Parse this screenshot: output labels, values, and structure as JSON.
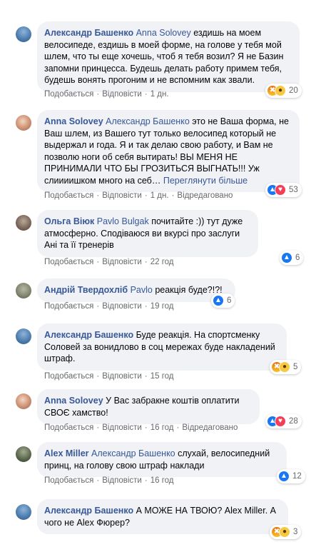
{
  "actions": {
    "like": "Подобається",
    "reply": "Відповісти",
    "edited": "Відредаговано"
  },
  "comments": [
    {
      "author": "Александр Башенко",
      "mention": "Anna Solovey",
      "text": "ездишь на моем велосипеде, ездишь в моей форме, на голове у тебя мой шлем, что ты еще хочешь, чтоб я тебя возил? Я не Базин запомни принцесса. Будешь делать работу примем тебя, будешь вонять прогоним и не вспомним как звали.",
      "time": "1 дн.",
      "reactions": [
        "angry-icon",
        "wow-icon"
      ],
      "count": "20"
    },
    {
      "author": "Anna Solovey",
      "mention": "Александр Башенко",
      "text": "это не Ваша форма, не Ваш шлем, из Вашего тут только велосипед который не выдержал и года. Я и так делаю свою работу, и Вам не позволю ноги об себя вытирать! ВЫ МЕНЯ НЕ ПРИНИМАЛИ ЧТО БЫ ГРОЗИТЬСЯ ВЫГНАТЬ!!! Уж слиииишком много на себ…",
      "more": "Переглянути більше",
      "time": "1 дн.",
      "edited": true,
      "reactions": [
        "like-icon",
        "love-icon"
      ],
      "count": "53"
    },
    {
      "author": "Ольга Віюк",
      "mention": "Pavlo Bulgak",
      "text": "почитайте :)) тут дуже атмосферно. Сподіваюся ви вкурсі про заслуги Ані та її тренерів",
      "time": "22 год",
      "reactions": [
        "like-icon"
      ],
      "count": "6"
    },
    {
      "author": "Андрій Твердохліб",
      "mention": "Pavlo",
      "text": "реакція буде?!?!",
      "time": "19 год",
      "reactions": [
        "like-icon"
      ],
      "count": "6"
    },
    {
      "author": "Александр Башенко",
      "mention": "",
      "text": "Буде реакція. На спортсменку Соловей за вонидлово в соц мережах буде накладений штраф.",
      "time": "15 год",
      "reactions": [
        "angry-icon",
        "haha-icon"
      ],
      "count": "5"
    },
    {
      "author": "Anna Solovey",
      "mention": "",
      "text": "У Вас забракне коштів оплатити СВОЄ хамство!",
      "time": "16 год",
      "edited": true,
      "reactions": [
        "like-icon",
        "love-icon"
      ],
      "count": "28"
    },
    {
      "author": "Alex Miller",
      "mention": "Александр Башенко",
      "text": "слухай, велосипедний принц, на голову свою штраф наклади",
      "time": "16 год",
      "reactions": [
        "like-icon"
      ],
      "count": "12"
    },
    {
      "author": "Александр Башенко",
      "mention": "",
      "text": "А МОЖЕ НА ТВОЮ? Alex Miller. А чого не Alex Фюрер?",
      "time": "",
      "reactions": [
        "angry-icon",
        "haha-icon"
      ],
      "count": "3"
    }
  ]
}
